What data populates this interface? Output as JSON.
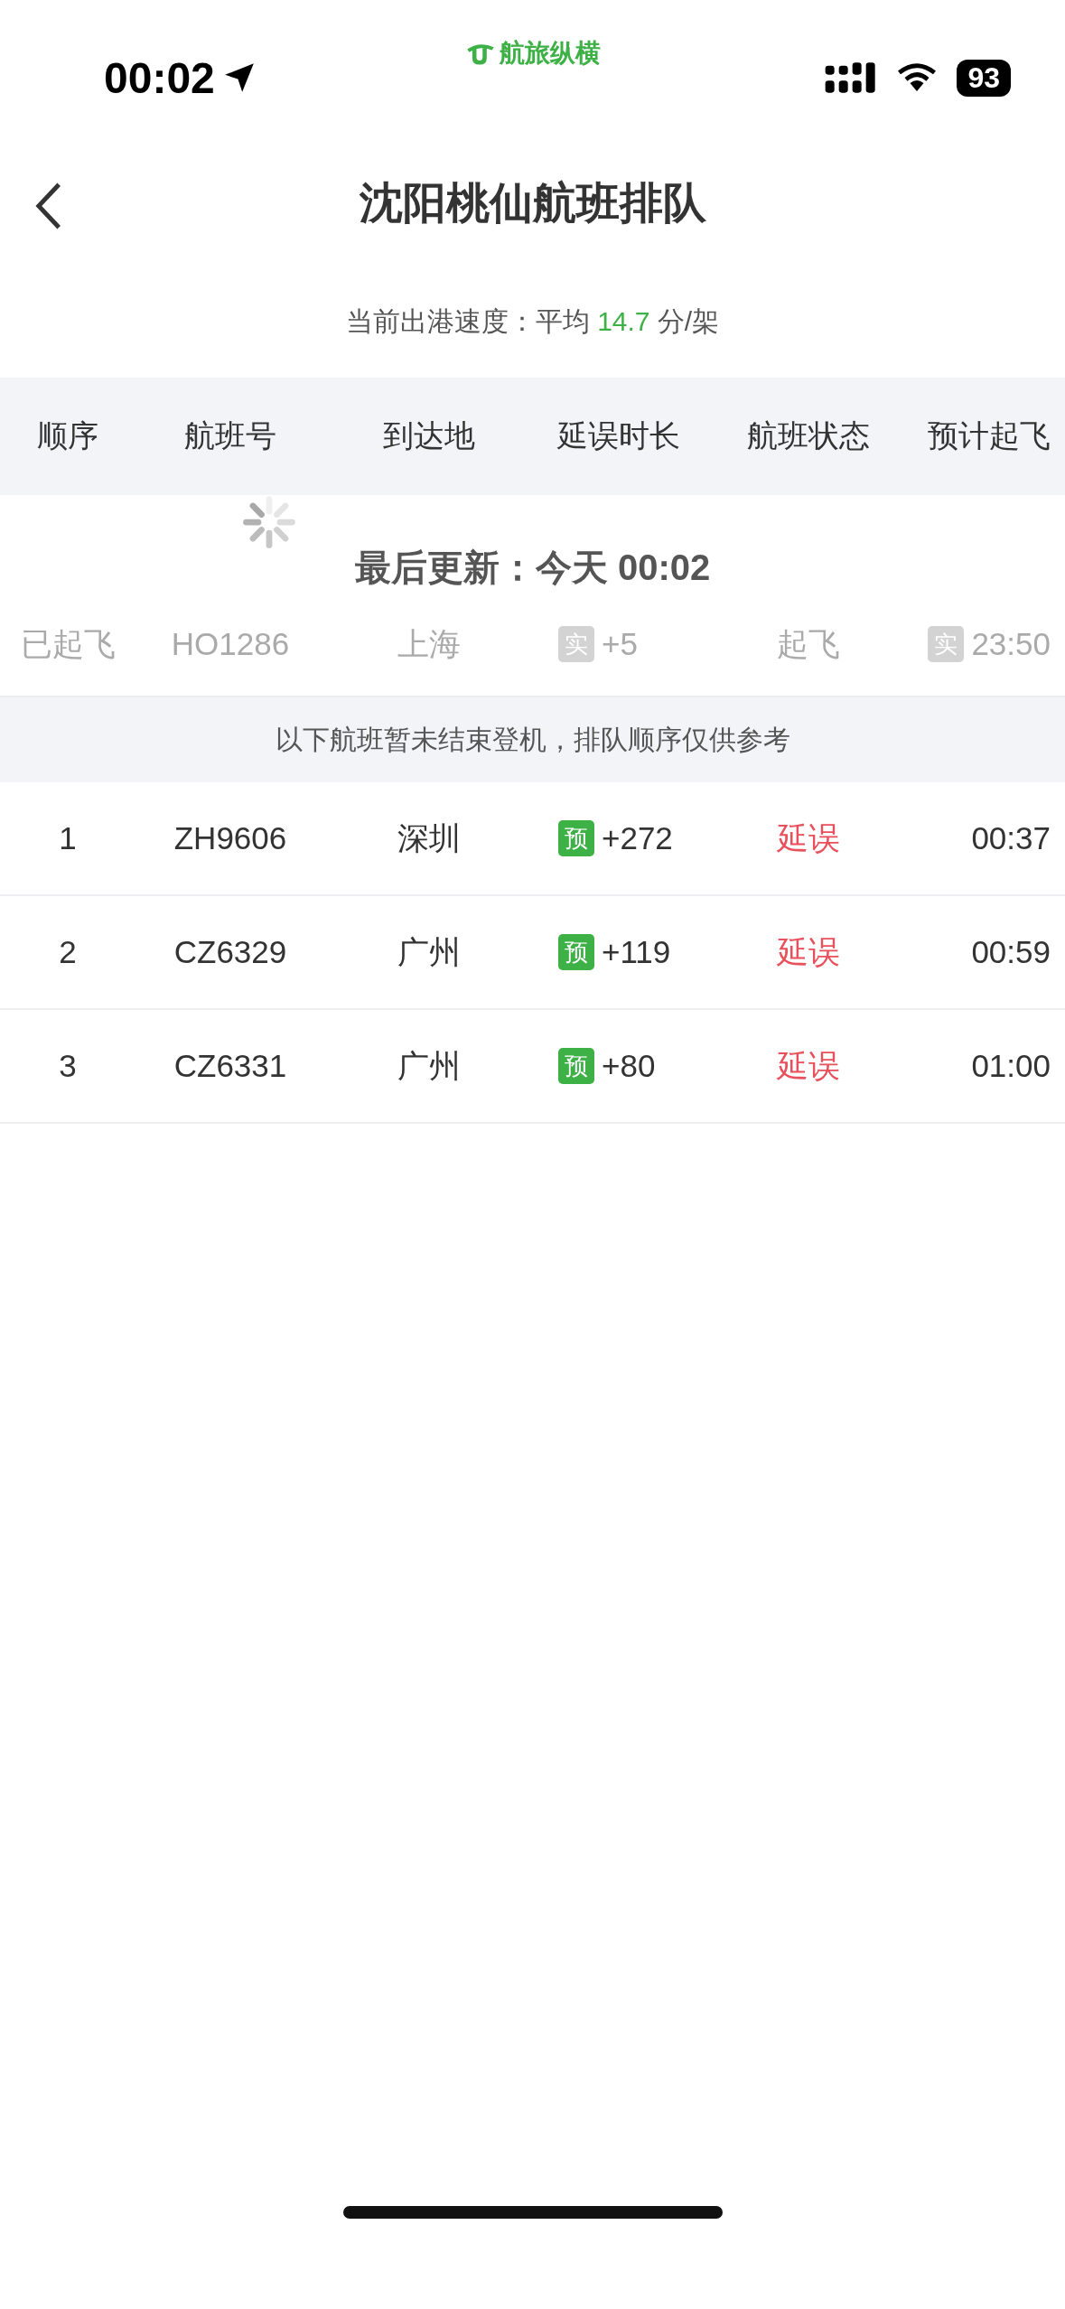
{
  "status_bar": {
    "time": "00:02",
    "battery": "93",
    "app_name": "航旅纵横"
  },
  "nav": {
    "title": "沈阳桃仙航班排队"
  },
  "speed": {
    "label": "当前出港速度：平均 ",
    "value": "14.7",
    "unit": " 分/架"
  },
  "table": {
    "columns": [
      "顺序",
      "航班号",
      "到达地",
      "延误时长",
      "航班状态",
      "预计起飞"
    ]
  },
  "refresh": {
    "text": "最后更新：今天 00:02"
  },
  "departed_rows": [
    {
      "kind": "departed",
      "order": "已起飞",
      "flight": "HO1286",
      "destination": "上海",
      "delay_badge": "实",
      "delay": "+5",
      "status": "起飞",
      "time_badge": "实",
      "time": "23:50"
    }
  ],
  "notice": "以下航班暂未结束登机，排队顺序仅供参考",
  "queue_rows": [
    {
      "kind": "queued",
      "order": "1",
      "flight": "ZH9606",
      "destination": "深圳",
      "delay_badge": "预",
      "delay": "+272",
      "status": "延误",
      "time": "00:37"
    },
    {
      "kind": "queued",
      "order": "2",
      "flight": "CZ6329",
      "destination": "广州",
      "delay_badge": "预",
      "delay": "+119",
      "status": "延误",
      "time": "00:59"
    },
    {
      "kind": "queued",
      "order": "3",
      "flight": "CZ6331",
      "destination": "广州",
      "delay_badge": "预",
      "delay": "+80",
      "status": "延误",
      "time": "01:00"
    }
  ]
}
